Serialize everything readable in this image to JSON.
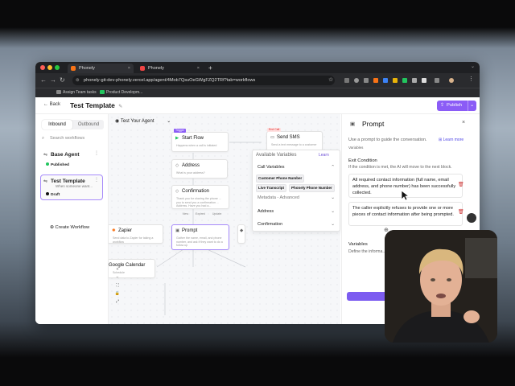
{
  "browser": {
    "tabs": [
      {
        "label": "Phonely"
      },
      {
        "label": "Phonely"
      }
    ],
    "new_tab": "+",
    "url": "phonely-git-dev-phonely.vercel.app/agent/4Mob7QsuOeGWgFZQ2TRf?tab=workflows",
    "bookmarks": [
      {
        "label": "Assign Team tasks"
      },
      {
        "label": "Product Developm..."
      }
    ]
  },
  "topbar": {
    "back_label": "Back",
    "title": "Test Template",
    "publish_label": "Publish"
  },
  "sidebar": {
    "tabs": [
      "Inbound",
      "Outbound"
    ],
    "search_placeholder": "Search workflows",
    "agents": [
      {
        "name": "Base Agent",
        "desc": "",
        "status": "Published"
      },
      {
        "name": "Test Template",
        "desc": "When someone want...",
        "status": "Draft"
      }
    ],
    "create_label": "Create Workflow"
  },
  "canvas": {
    "agent_selector": "Test Your Agent",
    "nodes": [
      {
        "title": "Start Flow",
        "tag": "Trigger",
        "sub": "Happens when a call is initiated"
      },
      {
        "title": "Send SMS",
        "tag": "End Call",
        "sub": "Send a text message to a customer"
      },
      {
        "title": "Address",
        "sub": "What is your address?"
      },
      {
        "title": "Confirmation",
        "sub": "Thank you for sharing the phone ... you to send you a confirmation ... Address. Have you had a..."
      },
      {
        "title": "Zapier",
        "sub": "Send data to Zapier for taking a workflow"
      },
      {
        "title": "Prompt",
        "sub": "Gather the name, email, and phone number, and ask if they want to do a follow up"
      },
      {
        "title": "Google Calendar",
        "sub": "Schedule"
      }
    ],
    "edge_labels": [
      "New",
      "Expired",
      "Update"
    ],
    "controls": [
      "+",
      "−",
      "⛶",
      "🔒",
      "⤢"
    ]
  },
  "available_variables": {
    "title": "Available Variables",
    "learn": "Learn",
    "sections": [
      {
        "label": "Call Variables",
        "chips": [
          "Customer Phone Number",
          "Live Transcript",
          "Phonely Phone Number"
        ]
      },
      {
        "label": "Metadata - Advanced"
      },
      {
        "label": "Address"
      },
      {
        "label": "Confirmation"
      }
    ]
  },
  "panel": {
    "title": "Prompt",
    "subtitle": "Use a prompt to guide the conversation.",
    "learn_more": "Learn more",
    "variables_small": "Variables",
    "exit_condition_label": "Exit Condition",
    "exit_condition_desc": "If the condition is met, the AI will move to the next block.",
    "conditions": [
      "All required contact information (full name, email address, and phone number) has been successfully collected.",
      "The caller explicitly refuses to provide one or more pieces of contact information after being prompted."
    ],
    "variables_label": "Variables",
    "variables_desc": "Define the informa..."
  },
  "colors": {
    "accent": "#8b5cf6",
    "published": "#22c55e",
    "draft": "#111111",
    "trigger_tag": "#8b5cf6",
    "end_tag": "#ef4444"
  }
}
